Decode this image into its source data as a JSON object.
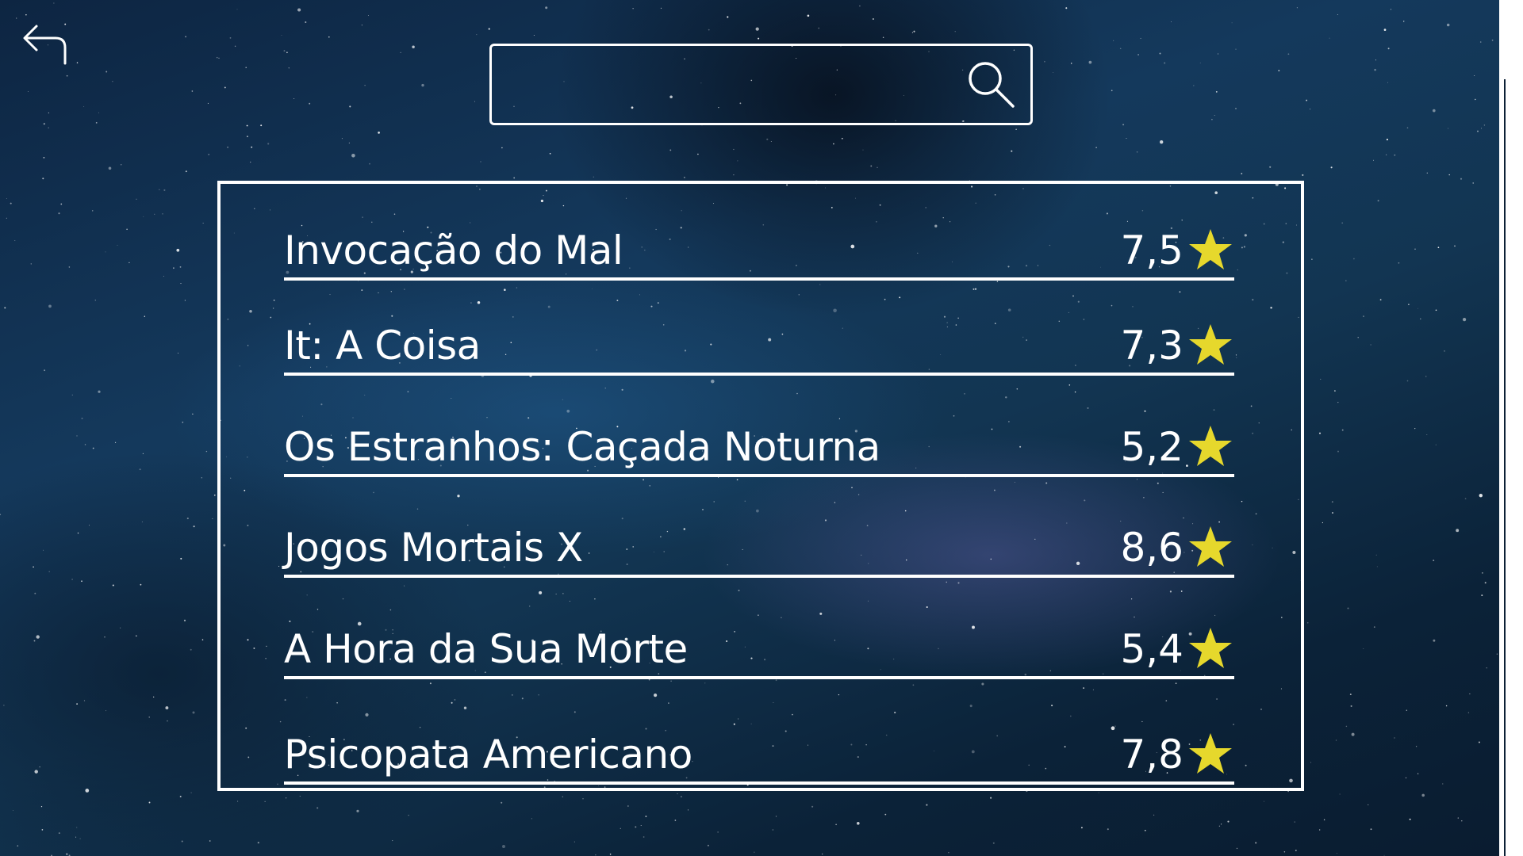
{
  "search": {
    "value": "",
    "placeholder": ""
  },
  "icons": {
    "back": "back-arrow-icon",
    "search": "search-icon",
    "rating": "star-icon"
  },
  "colors": {
    "text": "#ffffff",
    "star": "#e6d82c",
    "background": "#123552"
  },
  "movies": [
    {
      "title": "Invocação do Mal",
      "rating": "7,5"
    },
    {
      "title": "It:  A Coisa",
      "rating": "7,3"
    },
    {
      "title": "Os Estranhos: Caçada Noturna",
      "rating": "5,2"
    },
    {
      "title": "Jogos Mortais X",
      "rating": "8,6"
    },
    {
      "title": "A Hora da Sua Morte",
      "rating": "5,4"
    },
    {
      "title": "Psicopata Americano",
      "rating": "7,8"
    }
  ]
}
